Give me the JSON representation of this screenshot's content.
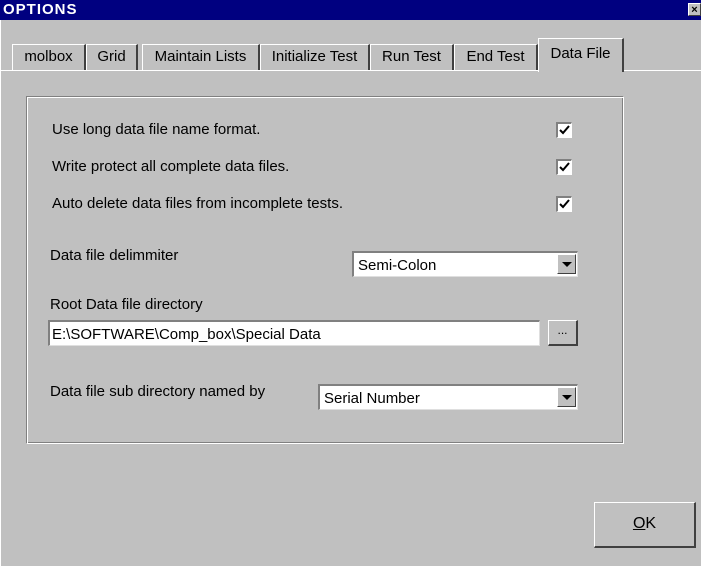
{
  "window": {
    "title": "OPTIONS",
    "close_glyph": "×"
  },
  "tabs": [
    {
      "label": "molbox"
    },
    {
      "label": "Grid"
    },
    {
      "label": "Maintain Lists"
    },
    {
      "label": "Initialize Test"
    },
    {
      "label": "Run Test"
    },
    {
      "label": "End Test"
    },
    {
      "label": "Data File",
      "active": true
    }
  ],
  "data_file": {
    "options": [
      {
        "label": "Use long data file name format.",
        "checked": true
      },
      {
        "label": "Write protect all complete data files.",
        "checked": true
      },
      {
        "label": "Auto delete data files from incomplete tests.",
        "checked": true
      }
    ],
    "delimiter": {
      "label": "Data file delimmiter",
      "value": "Semi-Colon"
    },
    "root_dir": {
      "label": "Root Data file directory",
      "value": "E:\\SOFTWARE\\Comp_box\\Special Data",
      "browse_label": "..."
    },
    "sub_dir": {
      "label": "Data file sub directory named by",
      "value": "Serial Number"
    }
  },
  "footer": {
    "ok_mnemonic": "O",
    "ok_rest": "K"
  }
}
